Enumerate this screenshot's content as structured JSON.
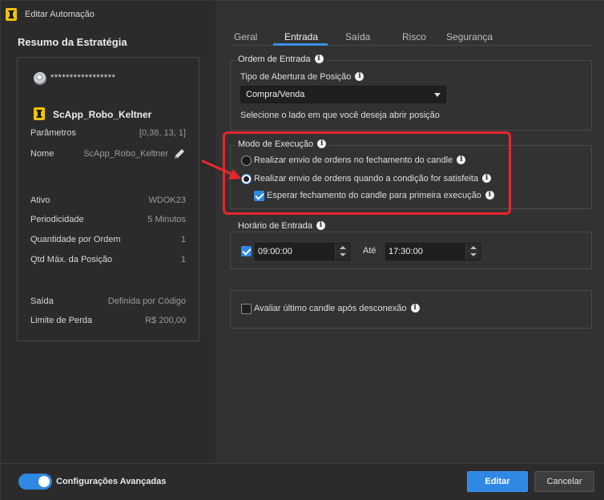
{
  "window": {
    "title": "Editar Automação",
    "close_glyph": "✕"
  },
  "summary": {
    "title": "Resumo da Estratégia",
    "account": "*****************",
    "robot_name": "ScApp_Robo_Keltner",
    "rows_top": [
      {
        "key": "Parâmetros",
        "value": "[0,38, 13, 1]"
      },
      {
        "key": "Nome",
        "value": "ScApp_Robo_Keltner"
      }
    ],
    "rows_mid": [
      {
        "key": "Ativo",
        "value": "WDOK23"
      },
      {
        "key": "Periodicidade",
        "value": "5 Minutos"
      },
      {
        "key": "Quantidade por Ordem",
        "value": "1"
      },
      {
        "key": "Qtd Máx. da Posição",
        "value": "1"
      }
    ],
    "rows_bottom": [
      {
        "key": "Saída",
        "value": "Definida por Código"
      },
      {
        "key": "Limite de Perda",
        "value": "R$ 200,00"
      }
    ]
  },
  "tabs": [
    "Geral",
    "Entrada",
    "Saída",
    "Risco",
    "Segurança"
  ],
  "active_tab": "Entrada",
  "entry_order": {
    "legend": "Ordem de Entrada",
    "type_label": "Tipo de Abertura de Posição",
    "selected": "Compra/Venda",
    "hint": "Selecione o lado em que você deseja abrir posição"
  },
  "exec_mode": {
    "legend": "Modo de Execução",
    "option_close": "Realizar envio de ordens no fechamento do candle",
    "option_condition": "Realizar envio de ordens quando a condição for satisfeita",
    "selected": "option_condition",
    "wait_close_label": "Esperar fechamento do candle para primeira execução",
    "wait_close_checked": true
  },
  "entry_time": {
    "legend": "Horário de Entrada",
    "enabled": true,
    "start": "09:00:00",
    "until_label": "Até",
    "end": "17:30:00"
  },
  "reconnect": {
    "label": "Avaliar último candle após desconexão",
    "checked": false
  },
  "footer": {
    "advanced_label": "Configurações Avançadas",
    "advanced_on": true,
    "edit_label": "Editar",
    "cancel_label": "Cancelar"
  },
  "colors": {
    "accent": "#2f88e3",
    "highlight": "#e8262d",
    "brand": "#f2c300"
  }
}
